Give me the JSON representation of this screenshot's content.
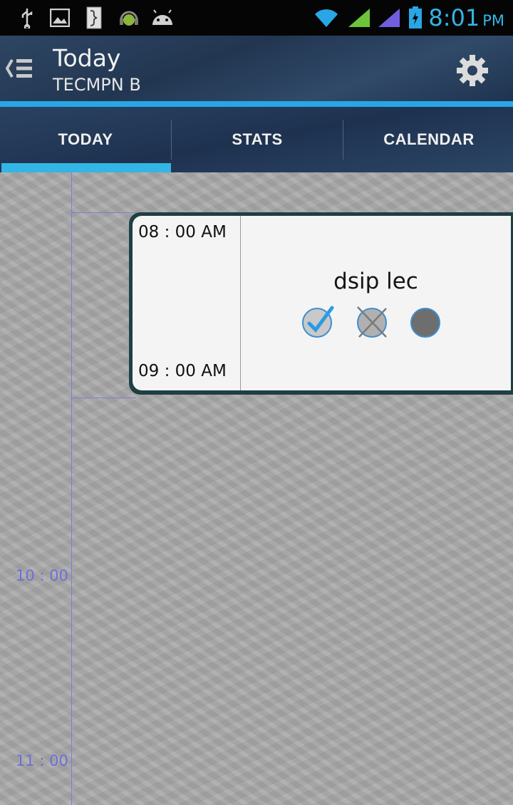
{
  "status_bar": {
    "time": "8:01",
    "ampm": "PM",
    "icons": [
      "usb-icon",
      "image-icon",
      "app-icon",
      "android-headphone-icon",
      "android-icon",
      "wifi-icon",
      "signal-icon",
      "signal-icon-2",
      "battery-charging-icon"
    ]
  },
  "action_bar": {
    "title": "Today",
    "subtitle": "TECMPN B",
    "settings_icon": "gear-icon",
    "accent": "#29a6e6"
  },
  "tabs": [
    {
      "label": "TODAY",
      "selected": true
    },
    {
      "label": "STATS",
      "selected": false
    },
    {
      "label": "CALENDAR",
      "selected": false
    }
  ],
  "timeline": {
    "hours": [
      "10 : 00",
      "11 : 00"
    ]
  },
  "event": {
    "start": "08 : 00 AM",
    "end": "09 : 00 AM",
    "name": "dsip lec",
    "actions": [
      "check-icon",
      "cancel-icon",
      "pending-icon"
    ]
  }
}
